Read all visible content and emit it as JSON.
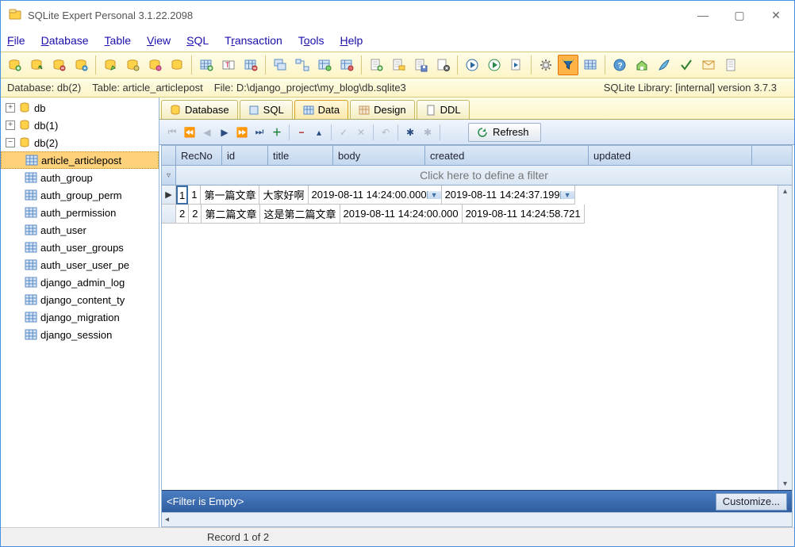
{
  "titlebar": {
    "title": "SQLite Expert Personal 3.1.22.2098"
  },
  "menus": [
    "File",
    "Database",
    "Table",
    "View",
    "SQL",
    "Transaction",
    "Tools",
    "Help"
  ],
  "infobar": {
    "database": "Database: db(2)",
    "table": "Table: article_articlepost",
    "file": "File: D:\\django_project\\my_blog\\db.sqlite3",
    "library": "SQLite Library: [internal] version 3.7.3"
  },
  "tree": {
    "roots": [
      {
        "label": "db",
        "expanded": false
      },
      {
        "label": "db(1)",
        "expanded": false
      },
      {
        "label": "db(2)",
        "expanded": true,
        "children": [
          "article_articlepost",
          "auth_group",
          "auth_group_perm",
          "auth_permission",
          "auth_user",
          "auth_user_groups",
          "auth_user_user_pe",
          "django_admin_log",
          "django_content_ty",
          "django_migration",
          "django_session"
        ]
      }
    ],
    "selected": "article_articlepost"
  },
  "tabs": {
    "items": [
      "Database",
      "SQL",
      "Data",
      "Design",
      "DDL"
    ],
    "active": "Data"
  },
  "navbar": {
    "refresh": "Refresh"
  },
  "grid": {
    "columns": [
      "RecNo",
      "id",
      "title",
      "body",
      "created",
      "updated"
    ],
    "filter_hint": "Click here to define a filter",
    "rows": [
      {
        "recno": "1",
        "id": "1",
        "title": "第一篇文章",
        "body": "大家好啊",
        "created": "2019-08-11 14:24:00.000",
        "updated": "2019-08-11 14:24:37.199"
      },
      {
        "recno": "2",
        "id": "2",
        "title": "第二篇文章",
        "body": "这是第二篇文章",
        "created": "2019-08-11 14:24:00.000",
        "updated": "2019-08-11 14:24:58.721"
      }
    ]
  },
  "filterstrip": {
    "text": "<Filter is Empty>",
    "customize": "Customize..."
  },
  "statusbar": {
    "record": "Record 1 of 2"
  }
}
